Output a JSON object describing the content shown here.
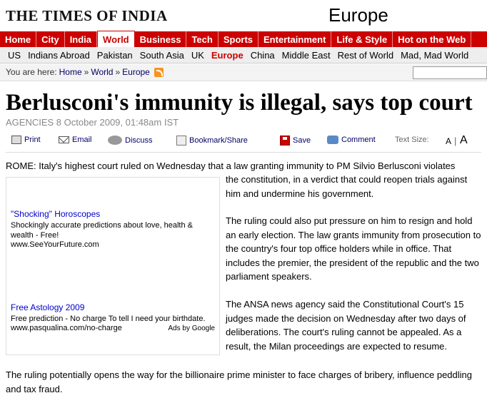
{
  "header": {
    "logo": "THE TIMES OF INDIA",
    "section": "Europe"
  },
  "main_nav": [
    "Home",
    "City",
    "India",
    "World",
    "Business",
    "Tech",
    "Sports",
    "Entertainment",
    "Life & Style",
    "Hot on the Web"
  ],
  "main_nav_active": "World",
  "sub_nav": [
    "US",
    "Indians Abroad",
    "Pakistan",
    "South Asia",
    "UK",
    "Europe",
    "China",
    "Middle East",
    "Rest of World",
    "Mad, Mad World"
  ],
  "sub_nav_active": "Europe",
  "breadcrumb": {
    "prefix": "You are here:",
    "items": [
      "Home",
      "World",
      "Europe"
    ],
    "separator": "»"
  },
  "search": {
    "placeholder": ""
  },
  "article": {
    "headline": "Berlusconi's immunity is illegal, says top court",
    "dateline": "AGENCIES 8 October 2009, 01:48am IST",
    "p1_line1": "ROME: Italy's highest court ruled on Wednesday that a law granting immunity to PM Silvio Berlusconi violates",
    "p1_rest": "the constitution, in a verdict that could reopen trials against him and undermine his government.",
    "p2": "The ruling could also put pressure on him to resign and hold an early election. The law grants immunity from prosecution to the country's four top office holders while in office. That includes the premier, the president of the republic and the two parliament speakers.",
    "p3": "The ANSA news agency said the Constitutional Court's 15 judges made the decision on Wednesday after two days of deliberations. The court's ruling cannot be appealed. As a result, the Milan proceedings are expected to resume.",
    "p4": "The ruling potentially opens the way for the billionaire prime minister to face charges of bribery, influence peddling and tax fraud."
  },
  "toolbar": {
    "print": "Print",
    "email": "Email",
    "discuss": "Discuss",
    "bookmark": "Bookmark/Share",
    "save": "Save",
    "comment": "Comment",
    "text_size_label": "Text Size:",
    "size_small": "A",
    "size_sep": "|",
    "size_large": "A"
  },
  "ads": {
    "ad1": {
      "title": "\"Shocking\" Horoscopes",
      "desc": "Shockingly accurate predictions about love, health & wealth - Free!",
      "url": "www.SeeYourFuture.com"
    },
    "ad2": {
      "title": "Free Astology 2009",
      "desc": "Free prediction - No charge To tell I need your birthdate.",
      "url": "www.pasqualina.com/no-charge"
    },
    "ads_by": "Ads by Google"
  },
  "colors": {
    "brand_red": "#cc0000",
    "link_blue": "#0000cc",
    "ad_link": "#0000cc"
  },
  "icons": [
    "print-icon",
    "email-icon",
    "discuss-icon",
    "bookmark-icon",
    "save-icon",
    "comment-icon",
    "rss-icon"
  ]
}
